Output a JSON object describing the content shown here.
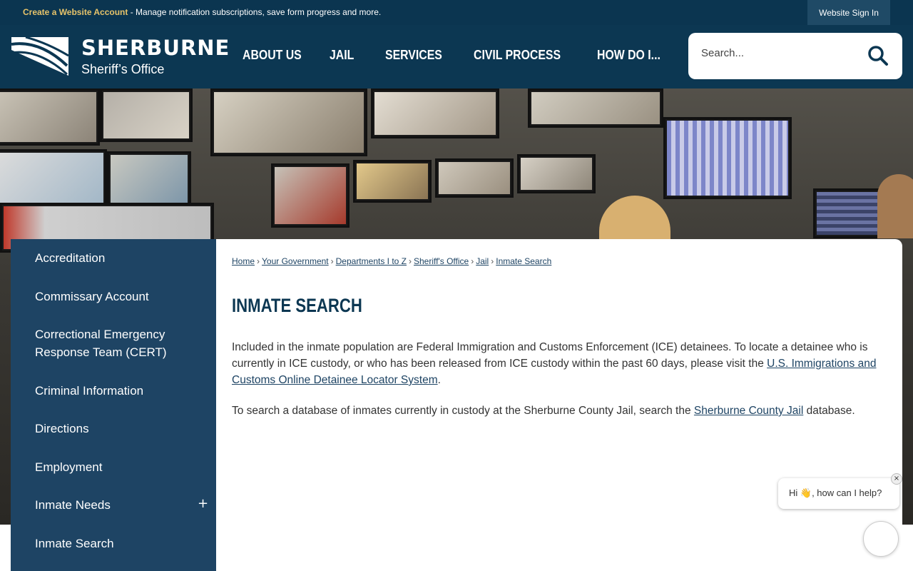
{
  "topbar": {
    "create_account_link": "Create a Website Account",
    "message": " - Manage notification subscriptions, save form progress and more.",
    "sign_in_label": "Website Sign In"
  },
  "header": {
    "logo_word": "SHERBURNE",
    "logo_sub": "Sheriff’s Office",
    "nav": [
      "ABOUT US",
      "JAIL",
      "SERVICES",
      "CIVIL PROCESS",
      "HOW DO I..."
    ],
    "search_placeholder": "Search..."
  },
  "sidebar": {
    "items": [
      "Accreditation",
      "Commissary Account",
      "Correctional Emergency Response Team (CERT)",
      "Criminal Information",
      "Directions",
      "Employment",
      "Inmate Needs",
      "Inmate Search"
    ],
    "expand_symbol": "+"
  },
  "breadcrumb": {
    "items": [
      "Home",
      "Your Government",
      "Departments I to Z",
      "Sheriff's Office",
      "Jail",
      "Inmate Search"
    ],
    "separator": "›"
  },
  "main": {
    "title": "INMATE SEARCH",
    "para1_text": "Included in the inmate population are Federal Immigration and Customs Enforcement (ICE) detainees. To locate a detainee who is currently in ICE custody, or who has been released from ICE custody within the past 60 days, please visit the ",
    "para1_link": "U.S. Immigrations and Customs Online Detainee Locator System",
    "para1_end": ".",
    "para2_text": "To search a database of inmates currently in custody at the Sherburne County Jail, search the ",
    "para2_link": "Sherburne County Jail",
    "para2_end": " database."
  },
  "chat": {
    "greeting": "Hi 👋, how can I help?",
    "close_symbol": "×"
  },
  "colors": {
    "header_bg": "#0c3752",
    "sidebar_bg": "#1e4464",
    "link": "#1e4464",
    "accent_gold": "#e6c36a"
  }
}
